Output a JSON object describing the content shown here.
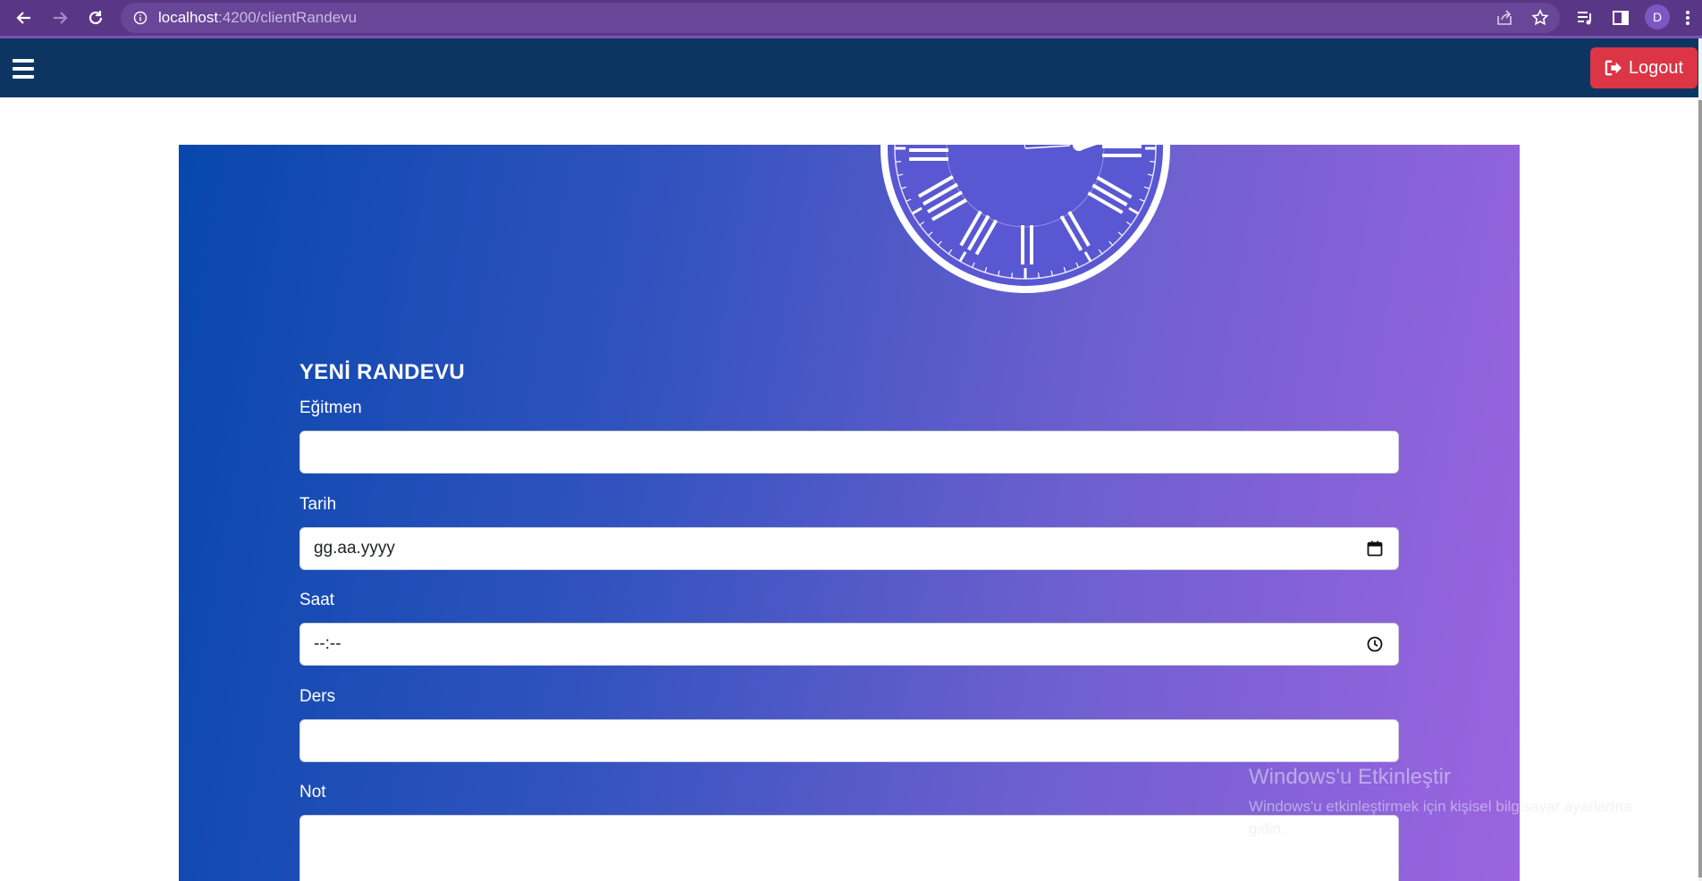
{
  "browser": {
    "url_host": "localhost",
    "url_path": ":4200/clientRandevu",
    "profile_initial": "D"
  },
  "navbar": {
    "logout_label": "Logout",
    "background": "#0c3562",
    "logout_color": "#dc3545"
  },
  "form": {
    "title": "YENİ RANDEVU",
    "fields": [
      {
        "label": "Eğitmen",
        "value": ""
      },
      {
        "label": "Tarih",
        "value": "gg.aa.yyyy",
        "icon": "calendar-icon"
      },
      {
        "label": "Saat",
        "value": "--:--",
        "icon": "clock-icon"
      },
      {
        "label": "Ders",
        "value": ""
      },
      {
        "label": "Not",
        "value": ""
      }
    ]
  },
  "watermark": {
    "title": "Windows'u Etkinleştir",
    "text": "Windows'u etkinleştirmek için kişisel bilgisayar ayarlarına gidin."
  }
}
